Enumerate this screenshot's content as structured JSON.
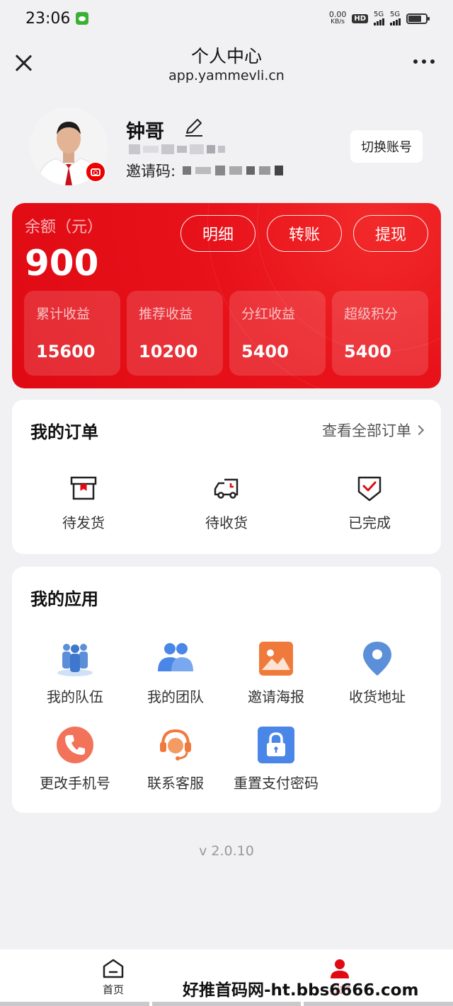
{
  "status_bar": {
    "time": "23:06",
    "speed_value": "0.00",
    "speed_unit": "KB/s",
    "hd": "HD",
    "network1": "5G",
    "network2": "5G"
  },
  "header": {
    "title": "个人中心",
    "url": "app.yammevli.cn"
  },
  "profile": {
    "name": "钟哥",
    "invite_prefix": "邀请码:",
    "switch_account_label": "切换账号"
  },
  "balance": {
    "label": "余额（元）",
    "value": "900",
    "buttons": [
      "明细",
      "转账",
      "提现"
    ],
    "stats": [
      {
        "label": "累计收益",
        "value": "15600"
      },
      {
        "label": "推荐收益",
        "value": "10200"
      },
      {
        "label": "分红收益",
        "value": "5400"
      },
      {
        "label": "超级积分",
        "value": "5400"
      }
    ]
  },
  "orders": {
    "title": "我的订单",
    "view_all": "查看全部订单",
    "items": [
      {
        "label": "待发货",
        "icon": "package-icon"
      },
      {
        "label": "待收货",
        "icon": "truck-icon"
      },
      {
        "label": "已完成",
        "icon": "check-shield-icon"
      }
    ]
  },
  "apps": {
    "title": "我的应用",
    "items": [
      {
        "label": "我的队伍",
        "icon": "group-icon"
      },
      {
        "label": "我的团队",
        "icon": "team-icon"
      },
      {
        "label": "邀请海报",
        "icon": "poster-icon"
      },
      {
        "label": "收货地址",
        "icon": "location-icon"
      },
      {
        "label": "更改手机号",
        "icon": "phone-icon"
      },
      {
        "label": "联系客服",
        "icon": "headset-icon"
      },
      {
        "label": "重置支付密码",
        "icon": "lock-icon"
      }
    ]
  },
  "version": "v 2.0.10",
  "bottom_nav": {
    "home": "首页",
    "mine": "我的"
  },
  "watermark": "好推首码网-ht.bbs6666.com",
  "colors": {
    "primary_red": "#e00a14",
    "background": "#f1f1f3",
    "blue_icon": "#4a86e8",
    "orange_icon": "#f0743a"
  }
}
